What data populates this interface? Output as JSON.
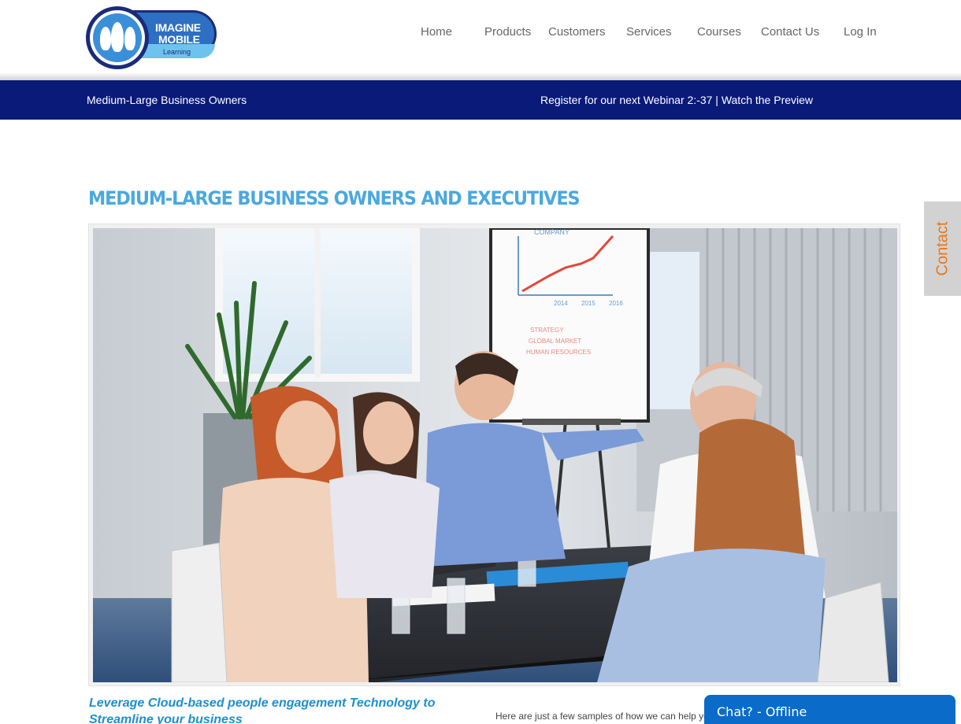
{
  "header": {
    "logo": {
      "line1": "IMAGINE",
      "line2": "MOBILE",
      "line3": "Learning"
    },
    "nav": [
      {
        "label": "Home"
      },
      {
        "label": "Products"
      },
      {
        "label": "Customers"
      },
      {
        "label": "Services"
      },
      {
        "label": "Courses"
      },
      {
        "label": "Contact Us"
      },
      {
        "label": "Log In"
      }
    ]
  },
  "banner": {
    "left": "Medium-Large Business Owners",
    "register": "Register for our next Webinar 2:-37",
    "separator": "|",
    "watch": "Watch the Preview"
  },
  "main": {
    "title": "MEDIUM-LARGE BUSINESS OWNERS AND EXECUTIVES",
    "flipchart": {
      "heading": "COMPANY",
      "years": [
        "2014",
        "2015",
        "2016"
      ],
      "notes": [
        "STRATEGY",
        "GLOBAL MARKET",
        "HUMAN RESOURCES"
      ]
    },
    "lead": "Leverage Cloud-based people engagement Technology to Streamline your business",
    "samples": "Here are just a few samples of how we can help yo"
  },
  "side_tab": {
    "label": "Contact"
  },
  "chat": {
    "label": "Chat? - Offline"
  },
  "colors": {
    "navy": "#0a1a78",
    "title_blue": "#4aa8df",
    "lead_blue": "#1c8fcf",
    "contact_orange": "#e8771c",
    "chat_blue": "#0a6bc9"
  }
}
